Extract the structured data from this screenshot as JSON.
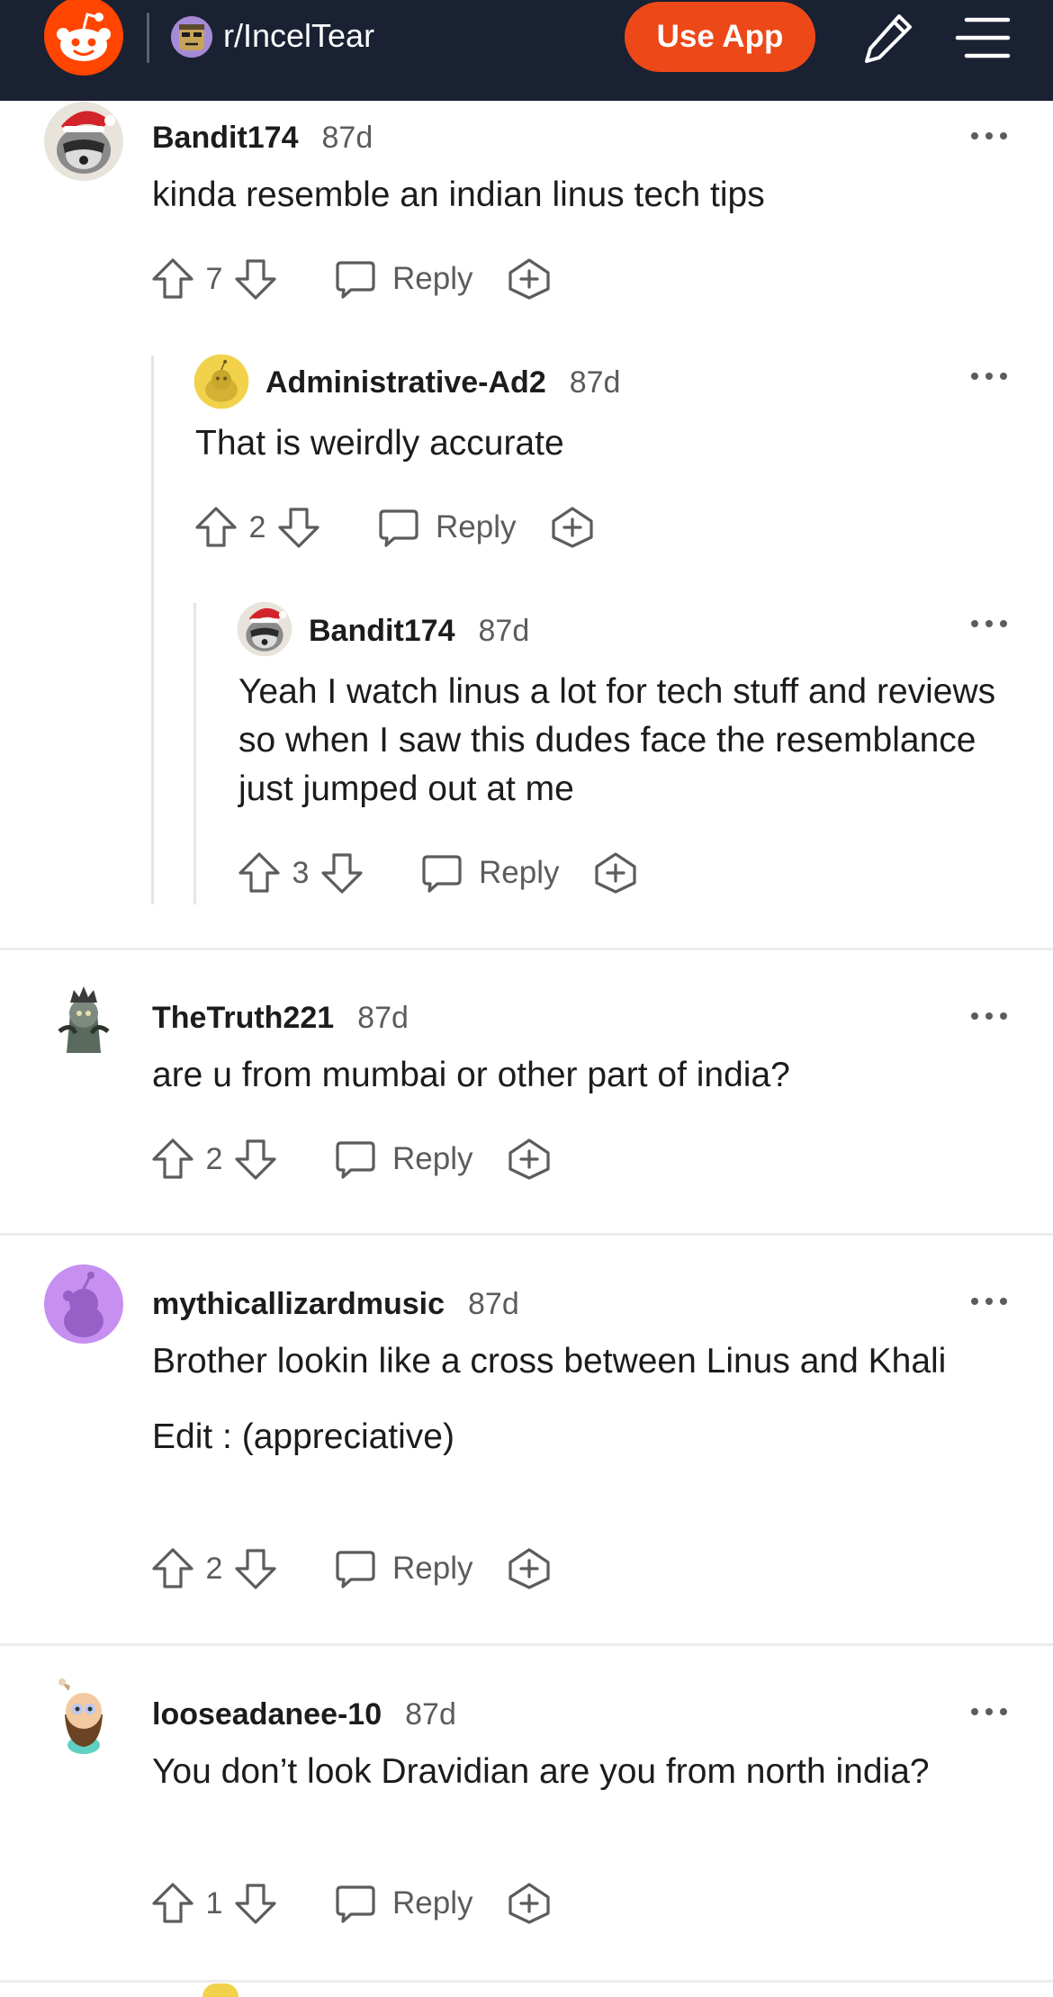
{
  "header": {
    "subreddit": "r/IncelTear",
    "use_app_label": "Use App",
    "icons": [
      "reddit-logo",
      "subreddit-avatar",
      "pencil-icon",
      "hamburger-icon"
    ],
    "colors": {
      "bar": "#1a2133",
      "accent": "#ed4818"
    }
  },
  "reply_label": "Reply",
  "comments": [
    {
      "author": "Bandit174",
      "age": "87d",
      "body": [
        "kinda resemble an indian linus tech tips"
      ],
      "score": "7"
    },
    {
      "author": "Administrative-Ad2",
      "age": "87d",
      "body": [
        "That is weirdly accurate"
      ],
      "score": "2"
    },
    {
      "author": "Bandit174",
      "age": "87d",
      "body": [
        "Yeah I watch linus a lot for tech stuff and reviews so when I saw this dudes face the resemblance just jumped out at me"
      ],
      "score": "3"
    },
    {
      "author": "TheTruth221",
      "age": "87d",
      "body": [
        "are u from mumbai or other part of india?"
      ],
      "score": "2"
    },
    {
      "author": "mythicallizardmusic",
      "age": "87d",
      "body": [
        "Brother lookin like a cross between Linus and Khali",
        "Edit : (appreciative)"
      ],
      "score": "2"
    },
    {
      "author": "looseadanee-10",
      "age": "87d",
      "body": [
        "You don’t look Dravidian are you from north india?"
      ],
      "score": "1"
    }
  ]
}
